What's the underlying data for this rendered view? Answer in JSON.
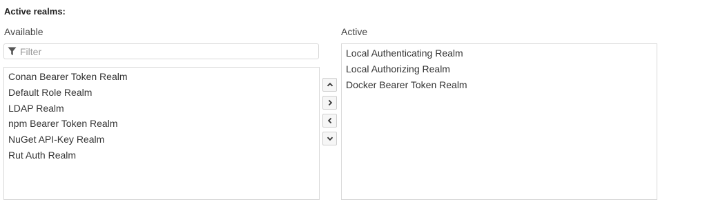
{
  "heading": "Active realms:",
  "available": {
    "label": "Available",
    "filter_placeholder": "Filter",
    "filter_icon": "filter-icon",
    "items": [
      "Conan Bearer Token Realm",
      "Default Role Realm",
      "LDAP Realm",
      "npm Bearer Token Realm",
      "NuGet API-Key Realm",
      "Rut Auth Realm"
    ]
  },
  "active": {
    "label": "Active",
    "items": [
      "Local Authenticating Realm",
      "Local Authorizing Realm",
      "Docker Bearer Token Realm"
    ]
  },
  "buttons": [
    {
      "name": "move-up-button",
      "icon": "chevron-up-icon"
    },
    {
      "name": "move-right-button",
      "icon": "chevron-right-icon"
    },
    {
      "name": "move-left-button",
      "icon": "chevron-left-icon"
    },
    {
      "name": "move-down-button",
      "icon": "chevron-down-icon"
    }
  ],
  "colors": {
    "border": "#d8d8d8",
    "text": "#333333",
    "placeholder": "#9a9a9a",
    "button_bg": "#f6f6f6"
  }
}
